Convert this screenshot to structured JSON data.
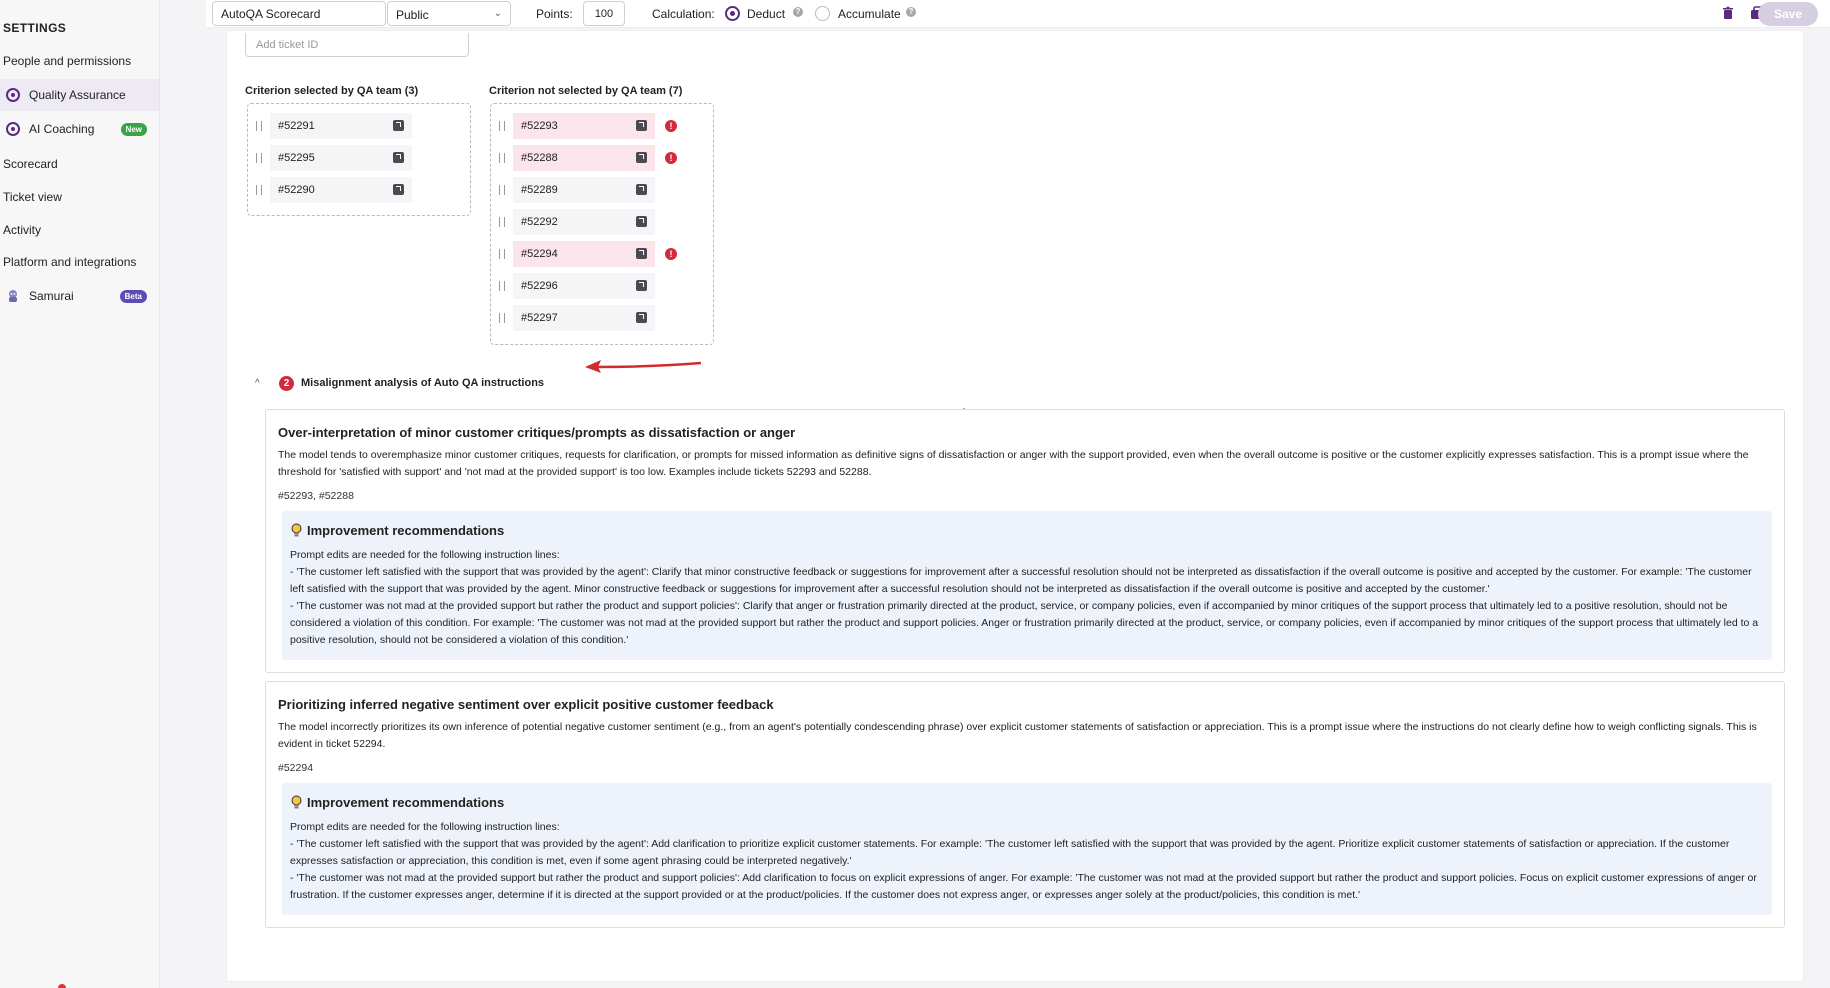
{
  "sidebar": {
    "heading": "SETTINGS",
    "items": [
      {
        "label": "People and permissions"
      },
      {
        "label": "Quality Assurance"
      },
      {
        "label": "AI Coaching",
        "badge": "New"
      },
      {
        "label": "Scorecard"
      },
      {
        "label": "Ticket view"
      },
      {
        "label": "Activity"
      },
      {
        "label": "Platform and integrations"
      },
      {
        "label": "Samurai",
        "badge": "Beta"
      }
    ]
  },
  "toolbar": {
    "name_value": "AutoQA Scorecard",
    "visibility": "Public",
    "points_label": "Points:",
    "points_value": "100",
    "calculation_label": "Calculation:",
    "deduct_label": "Deduct",
    "accumulate_label": "Accumulate",
    "help_glyph": "?",
    "save_label": "Save"
  },
  "main": {
    "ticket_placeholder": "Add ticket ID",
    "selected_title": "Criterion selected by QA team (3)",
    "selected": [
      "#52291",
      "#52295",
      "#52290"
    ],
    "not_selected_title": "Criterion not selected by QA team (7)",
    "not_selected": [
      {
        "id": "#52293",
        "flagged": true
      },
      {
        "id": "#52288",
        "flagged": true
      },
      {
        "id": "#52289",
        "flagged": false
      },
      {
        "id": "#52292",
        "flagged": false
      },
      {
        "id": "#52294",
        "flagged": true
      },
      {
        "id": "#52296",
        "flagged": false
      },
      {
        "id": "#52297",
        "flagged": false
      }
    ],
    "warn_glyph": "!",
    "section": {
      "count": "2",
      "title": "Misalignment analysis of Auto QA instructions",
      "caret": "^"
    },
    "issues": [
      {
        "title": "Over-interpretation of minor customer critiques/prompts as dissatisfaction or anger",
        "description": "The model tends to overemphasize minor customer critiques, requests for clarification, or prompts for missed information as definitive signs of dissatisfaction or anger with the support provided, even when the overall outcome is positive or the customer explicitly expresses satisfaction. This is a prompt issue where the threshold for 'satisfied with support' and 'not mad at the provided support' is too low. Examples include tickets 52293 and 52288.",
        "tickets": "#52293, #52288",
        "rec_title": "Improvement recommendations",
        "rec_intro": "Prompt edits are needed for the following instruction lines:",
        "rec_lines": [
          "- 'The customer left satisfied with the support that was provided by the agent': Clarify that minor constructive feedback or suggestions for improvement after a successful resolution should not be interpreted as dissatisfaction if the overall outcome is positive and accepted by the customer. For example: 'The customer left satisfied with the support that was provided by the agent. Minor constructive feedback or suggestions for improvement after a successful resolution should not be interpreted as dissatisfaction if the overall outcome is positive and accepted by the customer.'",
          "- 'The customer was not mad at the provided support but rather the product and support policies': Clarify that anger or frustration primarily directed at the product, service, or company policies, even if accompanied by minor critiques of the support process that ultimately led to a positive resolution, should not be considered a violation of this condition. For example: 'The customer was not mad at the provided support but rather the product and support policies. Anger or frustration primarily directed at the product, service, or company policies, even if accompanied by minor critiques of the support process that ultimately led to a positive resolution, should not be considered a violation of this condition.'"
        ]
      },
      {
        "title": "Prioritizing inferred negative sentiment over explicit positive customer feedback",
        "description": "The model incorrectly prioritizes its own inference of potential negative customer sentiment (e.g., from an agent's potentially condescending phrase) over explicit customer statements of satisfaction or appreciation. This is a prompt issue where the instructions do not clearly define how to weigh conflicting signals. This is evident in ticket 52294.",
        "tickets": "#52294",
        "rec_title": "Improvement recommendations",
        "rec_intro": "Prompt edits are needed for the following instruction lines:",
        "rec_lines": [
          "- 'The customer left satisfied with the support that was provided by the agent': Add clarification to prioritize explicit customer statements. For example: 'The customer left satisfied with the support that was provided by the agent. Prioritize explicit customer statements of satisfaction or appreciation. If the customer expresses satisfaction or appreciation, this condition is met, even if some agent phrasing could be interpreted negatively.'",
          "- 'The customer was not mad at the provided support but rather the product and support policies': Add clarification to focus on explicit expressions of anger. For example: 'The customer was not mad at the provided support but rather the product and support policies. Focus on explicit customer expressions of anger or frustration. If the customer expresses anger, determine if it is directed at the support provided or at the product/policies. If the customer does not express anger, or expresses anger solely at the product/policies, this condition is met.'"
        ]
      }
    ]
  },
  "colors": {
    "accent": "#5a2a82",
    "alert": "#d22b3b",
    "flag_bg": "#fbe4ea",
    "rec_bg": "#edf2fb"
  }
}
